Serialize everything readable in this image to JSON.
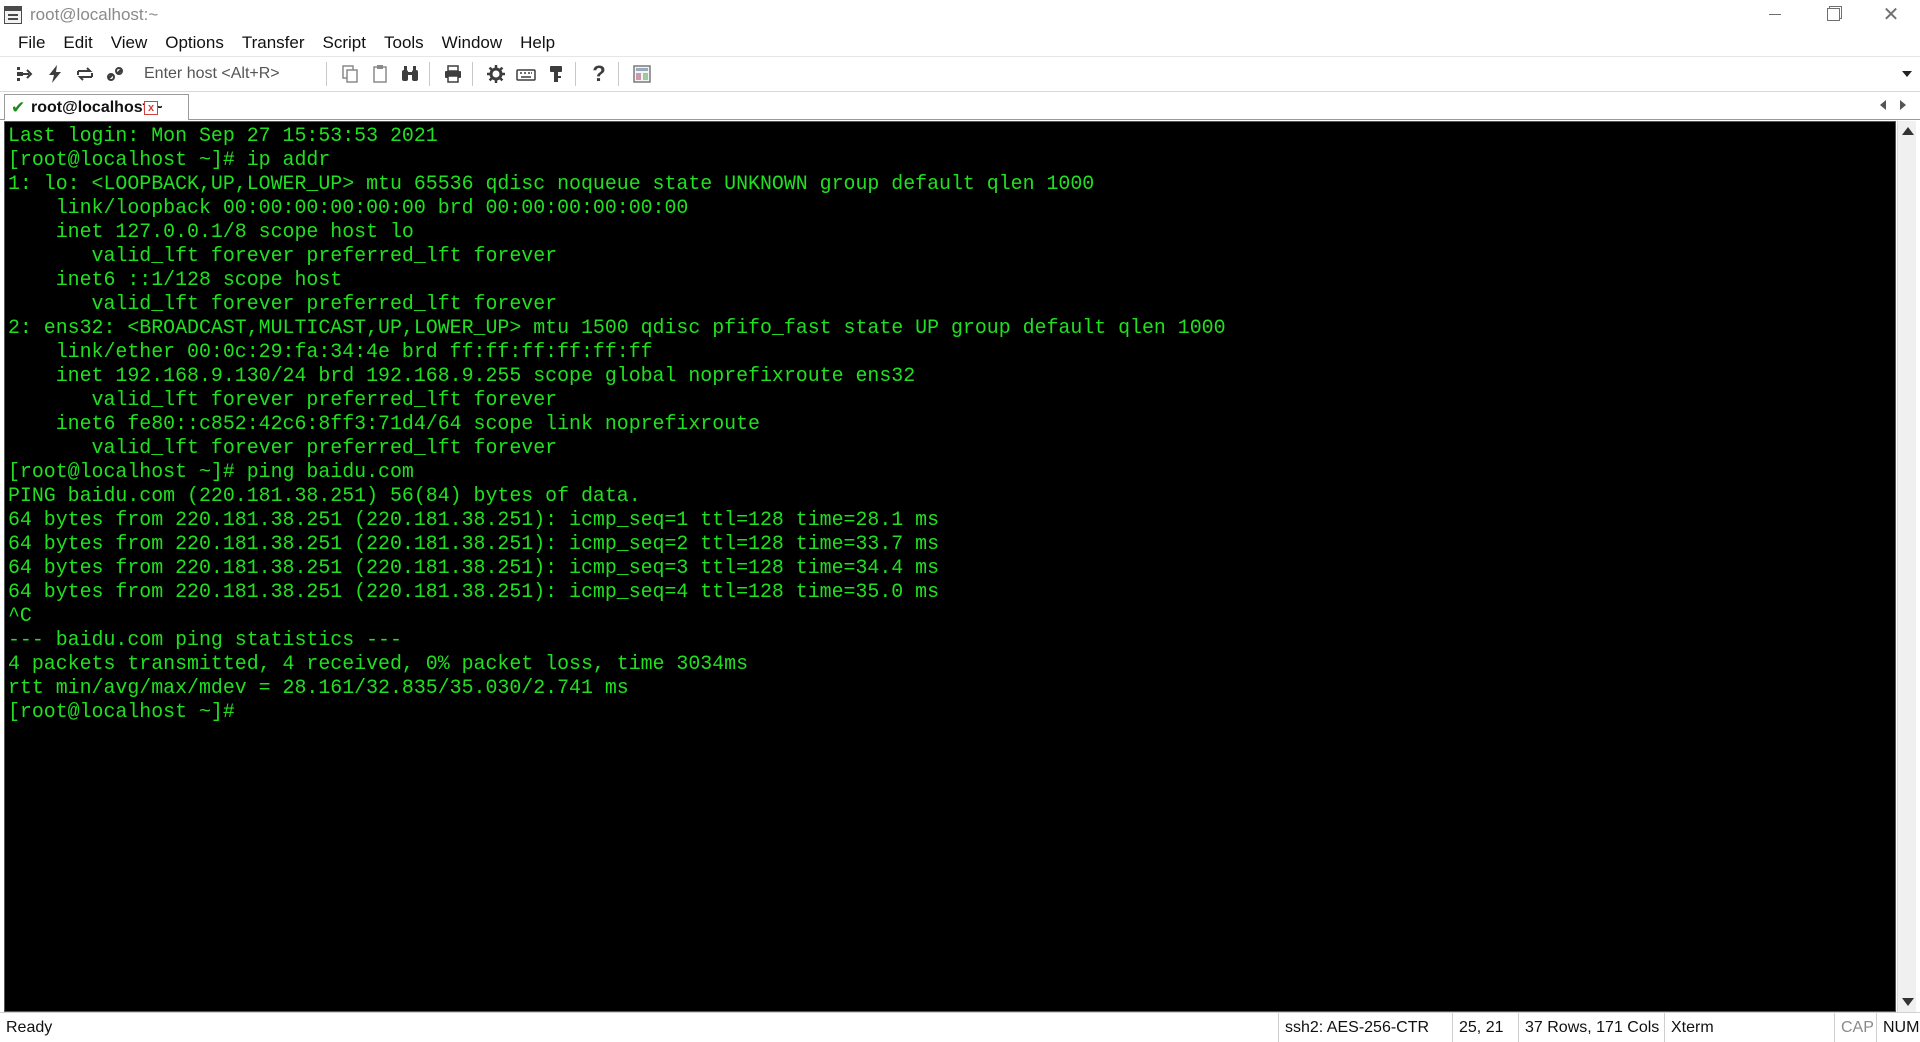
{
  "window": {
    "title": "root@localhost:~",
    "controls": [
      "minimize-icon",
      "restore-icon",
      "close-icon"
    ]
  },
  "menu": [
    "File",
    "Edit",
    "View",
    "Options",
    "Transfer",
    "Script",
    "Tools",
    "Window",
    "Help"
  ],
  "toolbar": {
    "host_placeholder": "Enter host <Alt+R>",
    "icons": [
      "connect-icon",
      "quick-connect-icon",
      "reconnect-icon",
      "disconnect-icon",
      "copy-icon",
      "paste-icon",
      "find-icon",
      "print-icon",
      "settings-icon",
      "keymap-icon",
      "key-icon",
      "help-icon",
      "session-manager-icon"
    ]
  },
  "tab": {
    "label": "root@localhost:~",
    "status": "connected"
  },
  "terminal": {
    "lines": [
      "Last login: Mon Sep 27 15:53:53 2021",
      "[root@localhost ~]# ip addr",
      "1: lo: <LOOPBACK,UP,LOWER_UP> mtu 65536 qdisc noqueue state UNKNOWN group default qlen 1000",
      "    link/loopback 00:00:00:00:00:00 brd 00:00:00:00:00:00",
      "    inet 127.0.0.1/8 scope host lo",
      "       valid_lft forever preferred_lft forever",
      "    inet6 ::1/128 scope host",
      "       valid_lft forever preferred_lft forever",
      "2: ens32: <BROADCAST,MULTICAST,UP,LOWER_UP> mtu 1500 qdisc pfifo_fast state UP group default qlen 1000",
      "    link/ether 00:0c:29:fa:34:4e brd ff:ff:ff:ff:ff:ff",
      "    inet 192.168.9.130/24 brd 192.168.9.255 scope global noprefixroute ens32",
      "       valid_lft forever preferred_lft forever",
      "    inet6 fe80::c852:42c6:8ff3:71d4/64 scope link noprefixroute",
      "       valid_lft forever preferred_lft forever",
      "[root@localhost ~]# ping baidu.com",
      "PING baidu.com (220.181.38.251) 56(84) bytes of data.",
      "64 bytes from 220.181.38.251 (220.181.38.251): icmp_seq=1 ttl=128 time=28.1 ms",
      "64 bytes from 220.181.38.251 (220.181.38.251): icmp_seq=2 ttl=128 time=33.7 ms",
      "64 bytes from 220.181.38.251 (220.181.38.251): icmp_seq=3 ttl=128 time=34.4 ms",
      "64 bytes from 220.181.38.251 (220.181.38.251): icmp_seq=4 ttl=128 time=35.0 ms",
      "^C",
      "--- baidu.com ping statistics ---",
      "4 packets transmitted, 4 received, 0% packet loss, time 3034ms",
      "rtt min/avg/max/mdev = 28.161/32.835/35.030/2.741 ms",
      "[root@localhost ~]#"
    ],
    "foreground_color": "#21e021",
    "background_color": "#000000"
  },
  "statusbar": {
    "ready": "Ready",
    "cipher": "ssh2: AES-256-CTR",
    "cursor": "25,  21",
    "size": "37 Rows, 171 Cols",
    "emulation": "Xterm",
    "caps": "CAP",
    "num": "NUM"
  }
}
